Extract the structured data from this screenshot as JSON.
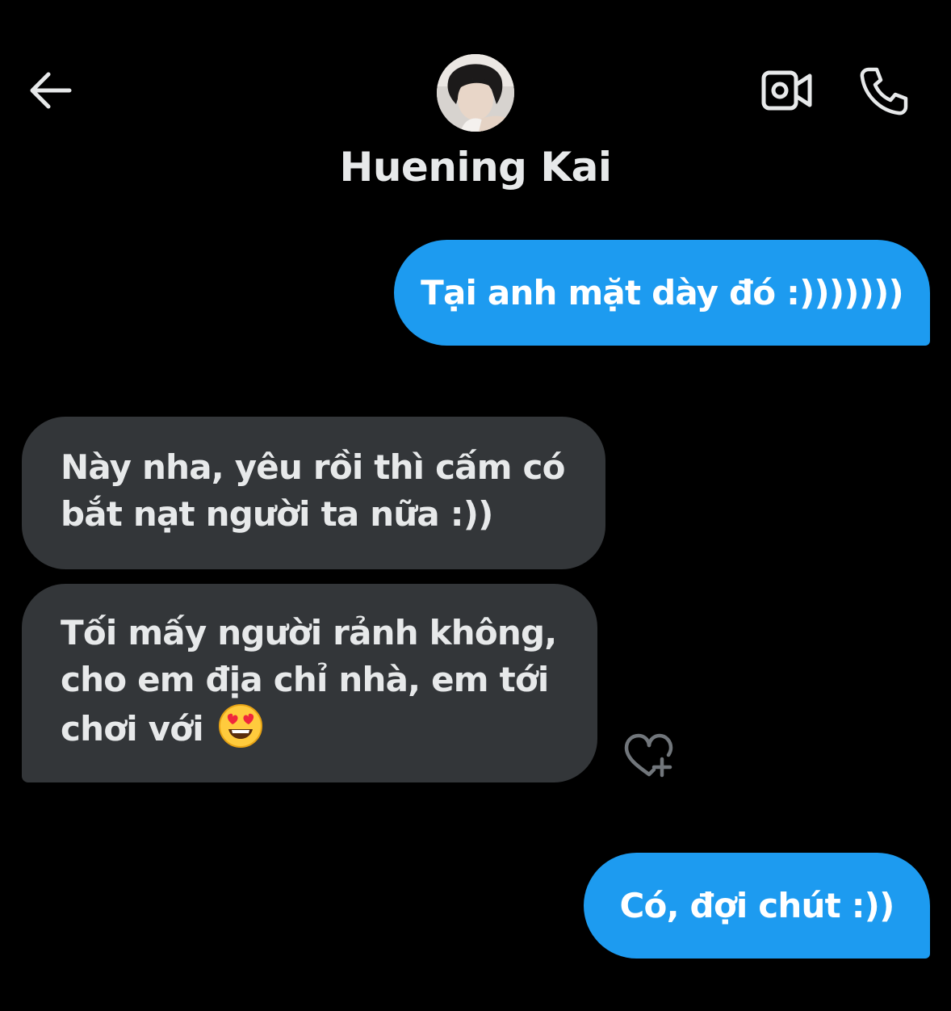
{
  "header": {
    "back_icon": "arrow-left-icon",
    "contact_name": "Huening Kai",
    "video_icon": "video-camera-icon",
    "call_icon": "phone-icon"
  },
  "messages": [
    {
      "direction": "outgoing",
      "text": "Tại anh mặt dày đó :)))))))"
    },
    {
      "direction": "incoming",
      "lines": [
        "Này nha, yêu rồi thì cấm có",
        "bắt nạt người ta nữa :))"
      ]
    },
    {
      "direction": "incoming",
      "lines": [
        "Tối mấy người rảnh không,",
        "cho em địa chỉ nhà, em tới",
        "chơi với"
      ],
      "emoji": "smiling-face-with-heart-eyes"
    },
    {
      "direction": "outgoing",
      "text": "Có, đợi chút :))"
    }
  ],
  "reaction_icon": "heart-plus-icon",
  "colors": {
    "background": "#000000",
    "outgoing_bubble": "#1d9bf0",
    "incoming_bubble": "#333639",
    "text_light": "#e7e9ea"
  }
}
